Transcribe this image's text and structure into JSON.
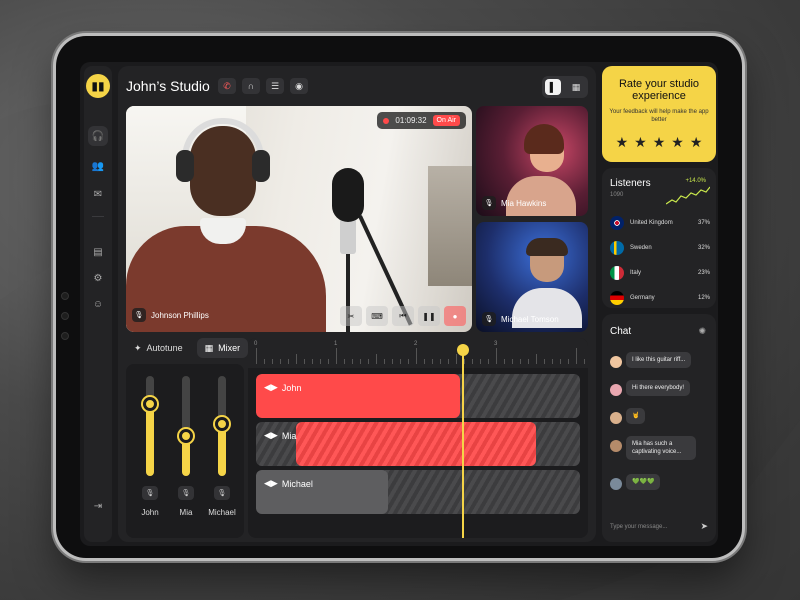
{
  "studio": {
    "title": "John’s Studio"
  },
  "header_icons": [
    "phone-off-icon",
    "headphones-icon",
    "chat-icon",
    "record-icon"
  ],
  "view_toggle": [
    "single-view-icon",
    "grid-view-icon"
  ],
  "rail": [
    "headphones-icon",
    "users-icon",
    "message-icon",
    "file-icon",
    "settings-icon",
    "user-icon",
    "logout-icon"
  ],
  "main_video": {
    "timer": "01:09:32",
    "status": "On Air",
    "name": "Johnson Phillips"
  },
  "side_videos": [
    {
      "name": "Mia Hawkins"
    },
    {
      "name": "Michael Tomson"
    }
  ],
  "tabs": {
    "autotune": "Autotune",
    "mixer": "Mixer"
  },
  "faders": [
    {
      "name": "John",
      "level": 0.28
    },
    {
      "name": "Mia",
      "level": 0.6
    },
    {
      "name": "Michael",
      "level": 0.48
    }
  ],
  "ruler": {
    "numbers": [
      "0",
      "1",
      "2",
      "3"
    ]
  },
  "tracks": [
    {
      "label": "John"
    },
    {
      "label": "Mia"
    },
    {
      "label": "Michael"
    }
  ],
  "rate": {
    "title": "Rate your studio experience",
    "subtitle": "Your feedback will help make the app better",
    "stars": 5
  },
  "listeners": {
    "title": "Listeners",
    "count": "1090",
    "growth": "+14.0%",
    "countries": [
      {
        "name": "United Kingdom",
        "pct": "37%"
      },
      {
        "name": "Sweden",
        "pct": "32%"
      },
      {
        "name": "Italy",
        "pct": "23%"
      },
      {
        "name": "Germany",
        "pct": "12%"
      }
    ]
  },
  "chat": {
    "title": "Chat",
    "messages": [
      {
        "text": "I like this guitar riff..."
      },
      {
        "text": "Hi there everybody!"
      },
      {
        "text": "🤘"
      },
      {
        "text": "Mia has such a captivating voice..."
      },
      {
        "text": "💚💚💚"
      }
    ],
    "input_placeholder": "Type your message..."
  },
  "colors": {
    "accent": "#f5d447",
    "live": "#ff4a4a",
    "panel": "#232325"
  }
}
